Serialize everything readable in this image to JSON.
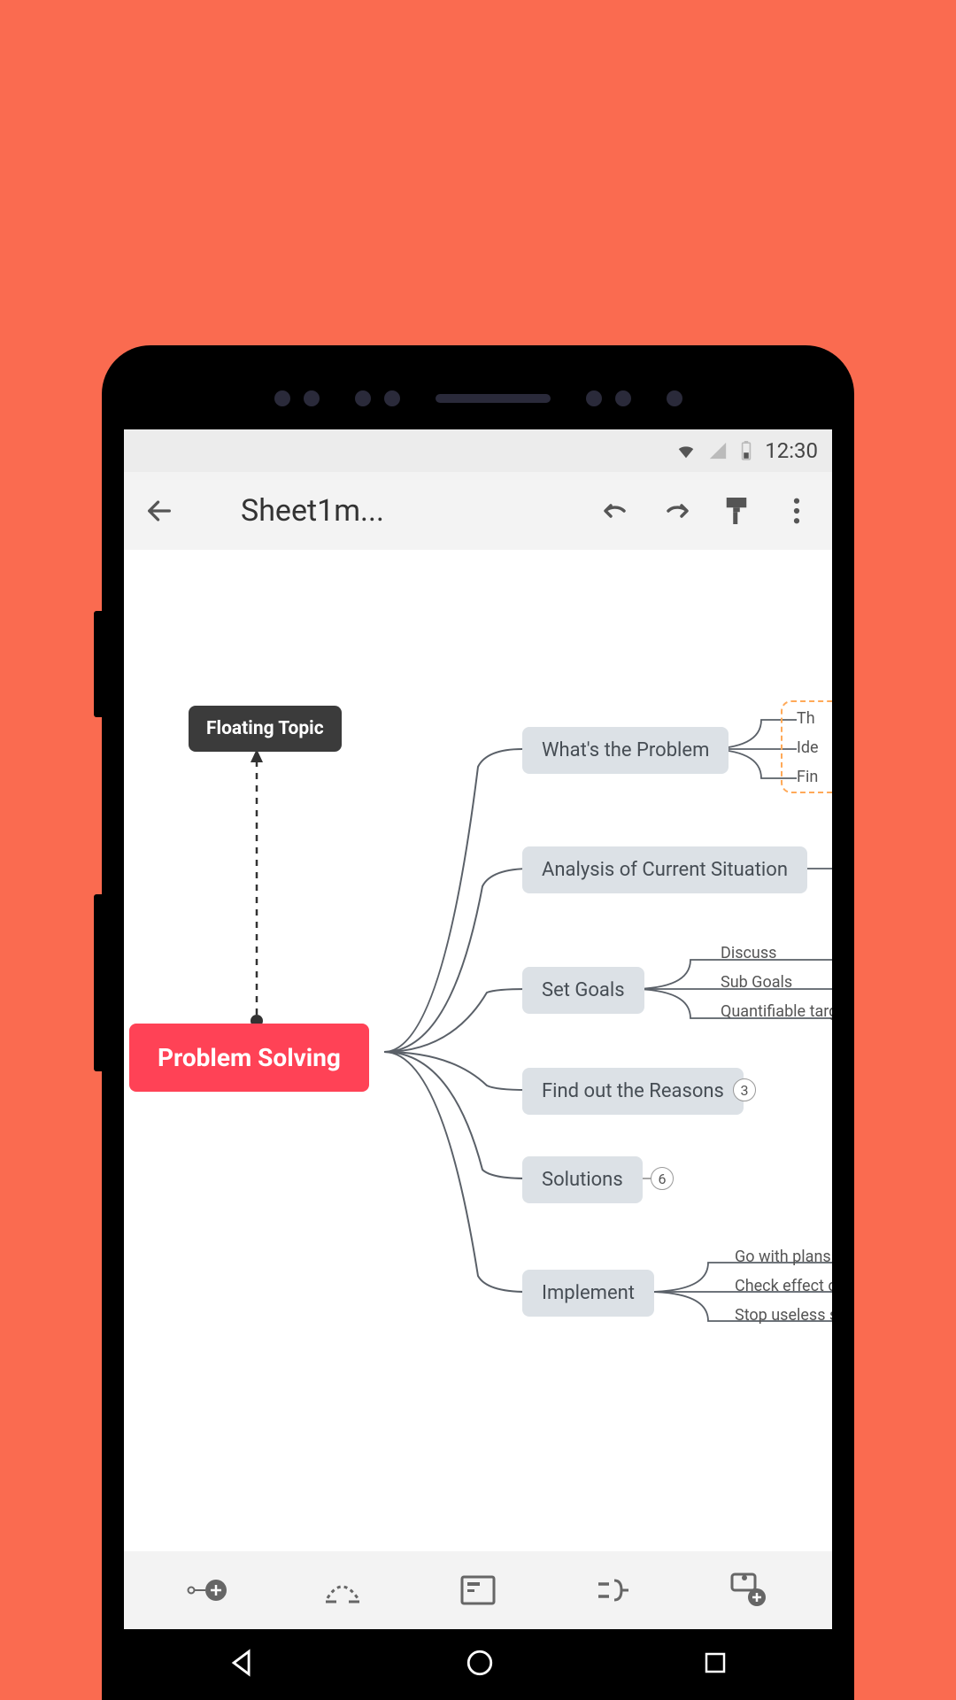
{
  "statusbar": {
    "time": "12:30"
  },
  "toolbar": {
    "title": "Sheet1m..."
  },
  "mindmap": {
    "floating_topic": "Floating Topic",
    "center": "Problem Solving",
    "branches": [
      {
        "label": "What's the Problem",
        "subs": [
          "Th",
          "Ide",
          "Fin"
        ]
      },
      {
        "label": "Analysis of Current Situation"
      },
      {
        "label": "Set Goals",
        "subs": [
          "Discuss",
          "Sub Goals",
          "Quantifiable targe"
        ]
      },
      {
        "label": "Find out the Reasons",
        "badge": "3"
      },
      {
        "label": "Solutions",
        "badge": "6"
      },
      {
        "label": "Implement",
        "subs": [
          "Go with plans",
          "Check effect of",
          "Stop useless so"
        ]
      }
    ]
  }
}
